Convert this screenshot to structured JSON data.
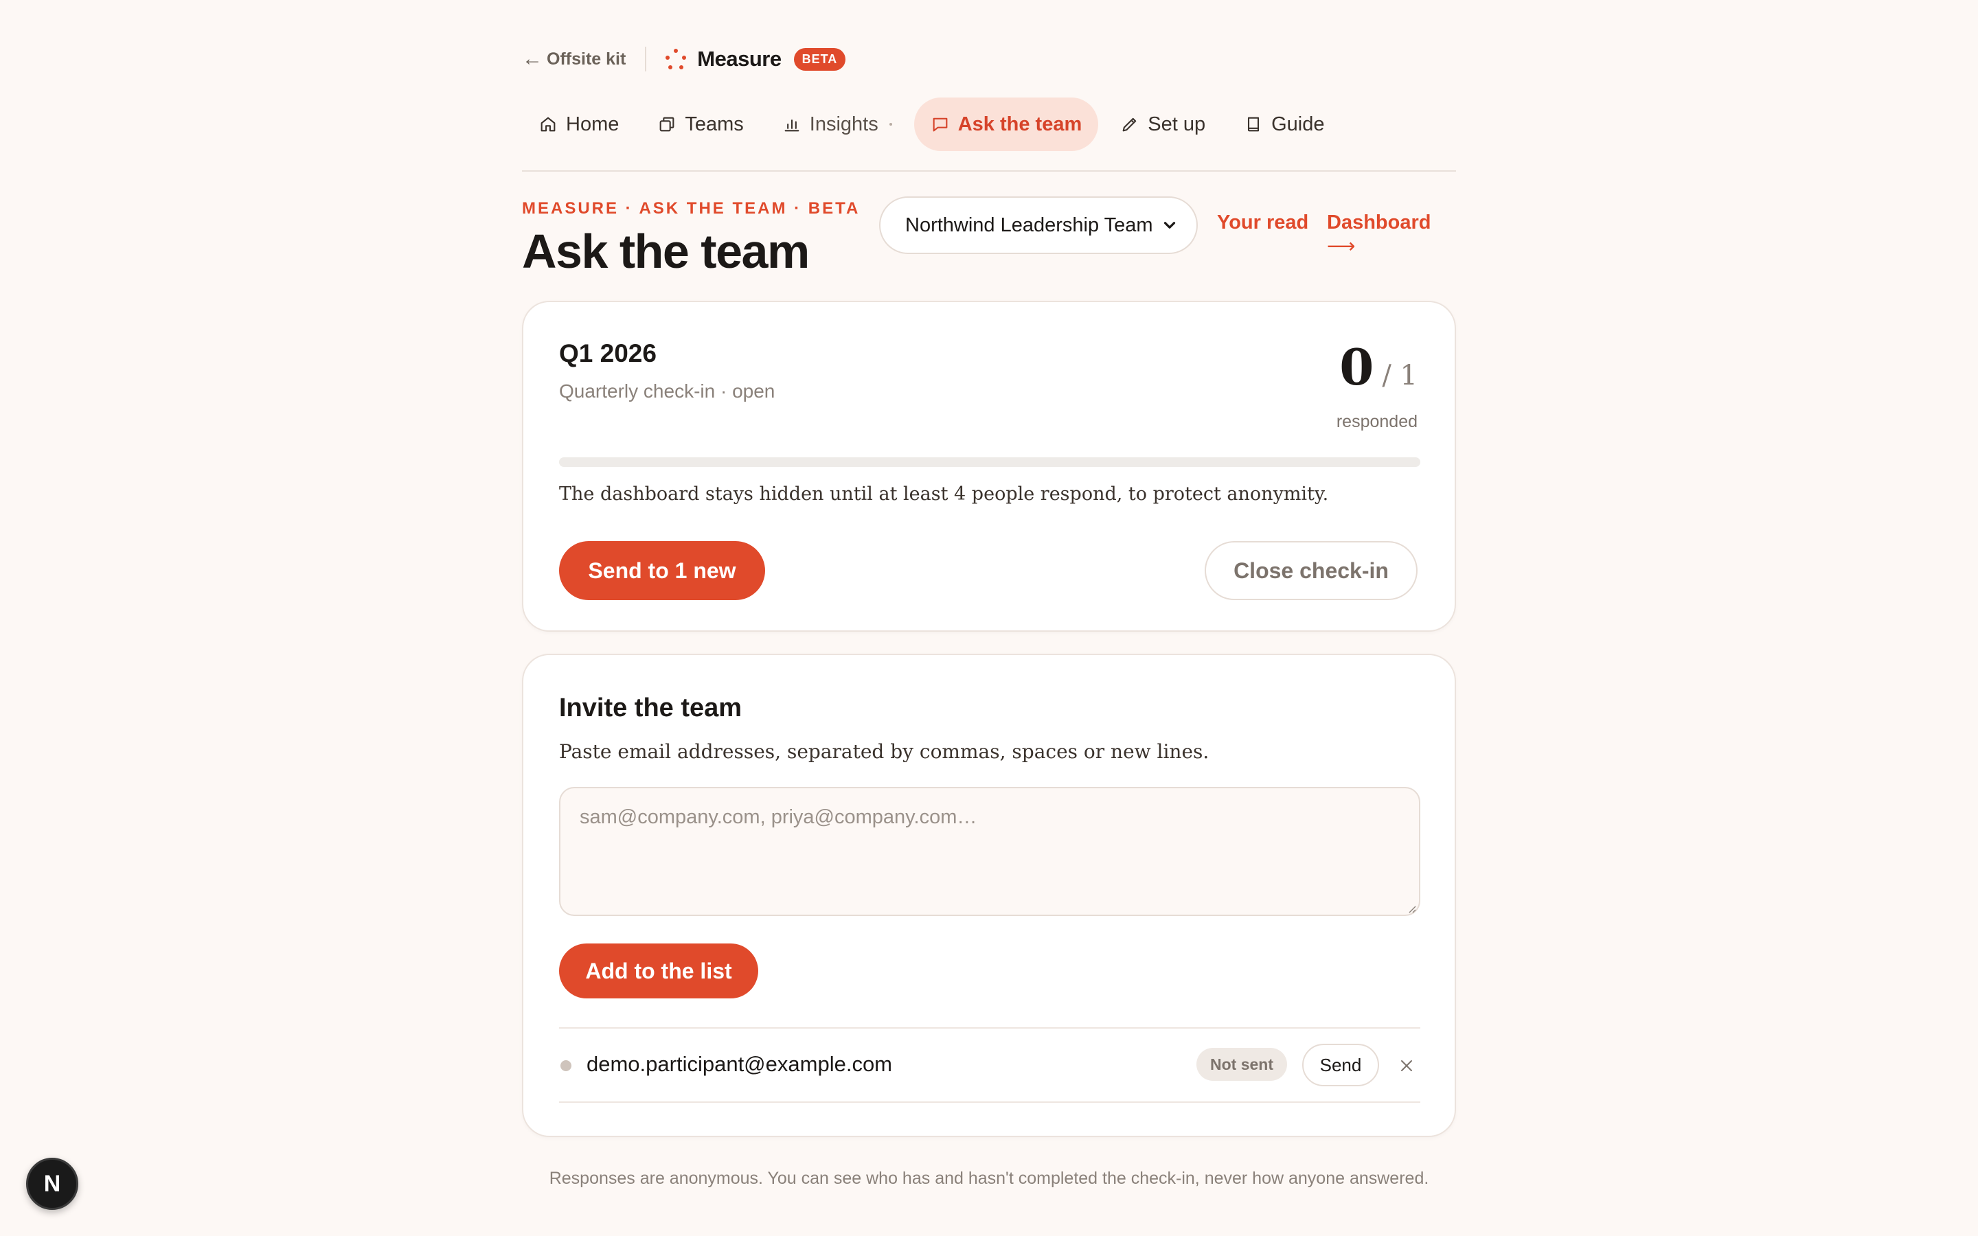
{
  "topbar": {
    "back_label": "Offsite kit",
    "brand_name": "Measure",
    "brand_badge": "BETA"
  },
  "nav": {
    "items": [
      {
        "label": "Home",
        "icon": "home-icon"
      },
      {
        "label": "Teams",
        "icon": "copy-icon"
      },
      {
        "label": "Insights",
        "icon": "bar-chart-icon"
      },
      {
        "label": "Ask the team",
        "icon": "chat-icon",
        "active": true
      },
      {
        "label": "Set up",
        "icon": "pencil-icon"
      },
      {
        "label": "Guide",
        "icon": "book-icon"
      }
    ]
  },
  "header": {
    "eyebrow": "MEASURE · ASK THE TEAM · BETA",
    "title": "Ask the team",
    "team_select": "Northwind Leadership Team",
    "link_your_read": "Your read",
    "link_dashboard": "Dashboard"
  },
  "checkin": {
    "period": "Q1 2026",
    "subtitle": "Quarterly check-in · open",
    "responded": "0",
    "total": "/ 1",
    "responded_label": "responded",
    "progress_fraction": 0,
    "notice": "The dashboard stays hidden until at least 4 people respond, to protect anonymity.",
    "send_button": "Send to 1 new",
    "close_button": "Close check-in"
  },
  "invite": {
    "title": "Invite the team",
    "subtitle": "Paste email addresses, separated by commas, spaces or new lines.",
    "placeholder": "sam@company.com, priya@company.com…",
    "add_button": "Add to the list",
    "rows": [
      {
        "email": "demo.participant@example.com",
        "status": "Not sent",
        "action": "Send"
      }
    ]
  },
  "footer": {
    "note": "Responses are anonymous. You can see who has and hasn't completed the check-in, never how anyone answered."
  },
  "dev_badge": "N",
  "colors": {
    "accent": "#e04a2b",
    "background": "#fdf8f5",
    "active_tab_bg": "#fbe1d8"
  }
}
